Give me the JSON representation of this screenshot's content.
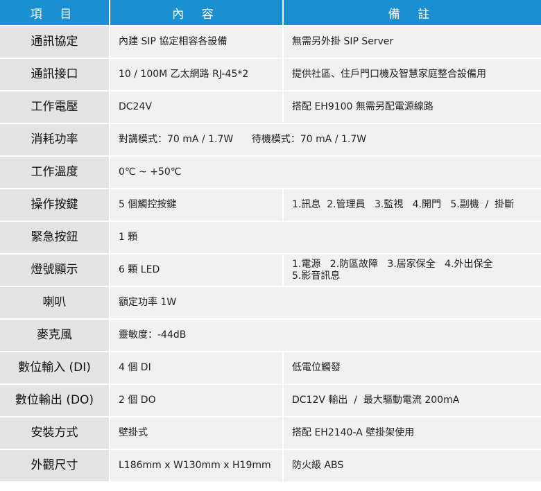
{
  "header": {
    "item": "項 目",
    "content": "內 容",
    "note": "備 註"
  },
  "rows": [
    {
      "label": "通訊協定",
      "content": "內建 SIP 協定相容各設備",
      "note": "無需另外掛 SIP Server"
    },
    {
      "label": "通訊接口",
      "content": "10 / 100M 乙太網路 RJ-45*2",
      "note": "提供社區、住戶門口機及智慧家庭整合設備用"
    },
    {
      "label": "工作電壓",
      "content": "DC24V",
      "note": "搭配 EH9100 無需另配電源線路"
    },
    {
      "label": "消耗功率",
      "content": "對講模式：70 mA / 1.7W      待機模式：70 mA / 1.7W"
    },
    {
      "label": "工作溫度",
      "content": "0℃ ~ +50℃"
    },
    {
      "label": "操作按鍵",
      "content": "5 個觸控按鍵",
      "note": "1.訊息  2.管理員   3.監視   4.開門   5.副機  /  掛斷"
    },
    {
      "label": "緊急按鈕",
      "content": "1 顆"
    },
    {
      "label": "燈號顯示",
      "content": "6 顆 LED",
      "note_line1": "1.電源   2.防區故障   3.居家保全   4.外出保全",
      "note_line2": "5.影音訊息"
    },
    {
      "label": "喇叭",
      "content": "額定功率 1W"
    },
    {
      "label": "麥克風",
      "content": "靈敏度：-44dB"
    },
    {
      "label": "數位輸入 (DI)",
      "content": "4 個 DI",
      "note": "低電位觸發"
    },
    {
      "label": "數位輸出 (DO)",
      "content": "2 個 DO",
      "note": "DC12V 輸出  /  最大驅動電流 200mA"
    },
    {
      "label": "安裝方式",
      "content": "壁掛式",
      "note": "搭配 EH2140-A 壁掛架使用"
    },
    {
      "label": "外觀尺寸",
      "content": "L186mm x W130mm x H19mm",
      "note": "防火級 ABS"
    }
  ]
}
